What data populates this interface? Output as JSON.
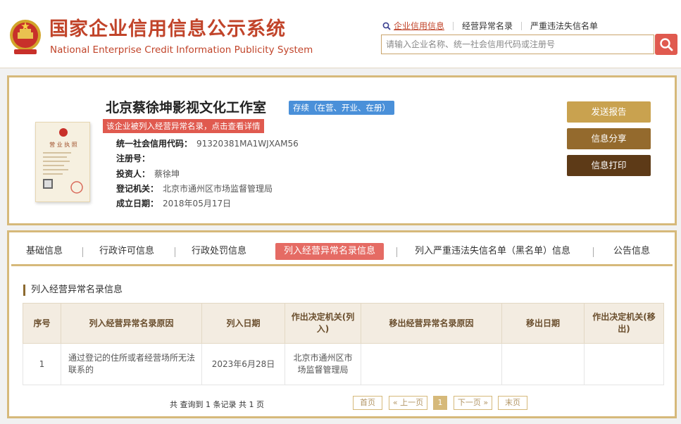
{
  "header": {
    "title_cn": "国家企业信用信息公示系统",
    "title_en": "National Enterprise Credit Information Publicity System",
    "links": [
      "企业信用信息",
      "经营异常名录",
      "严重违法失信名单"
    ],
    "search_placeholder": "请输入企业名称、统一社会信用代码或注册号"
  },
  "company": {
    "name": "北京蔡徐坤影视文化工作室",
    "status": "存续（在营、开业、在册）",
    "alert": "该企业被列入经营异常名录，点击查看详情",
    "fields": [
      {
        "label": "统一社会信用代码：",
        "value": "91320381MA1WJXAM56"
      },
      {
        "label": "注册号：",
        "value": ""
      },
      {
        "label": "投资人：",
        "value": "蔡徐坤"
      },
      {
        "label": "登记机关：",
        "value": "北京市通州区市场监督管理局"
      },
      {
        "label": "成立日期：",
        "value": "2018年05月17日"
      }
    ],
    "license_text": "营 业 执 照",
    "buttons": {
      "report": "发送报告",
      "share": "信息分享",
      "print": "信息打印"
    }
  },
  "tabs": [
    "基础信息",
    "行政许可信息",
    "行政处罚信息",
    "列入经营异常名录信息",
    "列入严重违法失信名单（黑名单）信息",
    "公告信息"
  ],
  "section": {
    "title": "列入经营异常名录信息",
    "columns": [
      "序号",
      "列入经营异常名录原因",
      "列入日期",
      "作出决定机关(列入)",
      "移出经营异常名录原因",
      "移出日期",
      "作出决定机关(移出)"
    ],
    "rows": [
      [
        "1",
        "通过登记的住所或者经营场所无法联系的",
        "2023年6月28日",
        "北京市通州区市场监督管理局",
        "",
        "",
        ""
      ]
    ]
  },
  "pagination": {
    "summary": "共 查询到 1 条记录 共 1 页",
    "first": "首页",
    "prev": "« 上一页",
    "current": "1",
    "next": "下一页 »",
    "last": "末页"
  },
  "colors": {
    "brand_red": "#c1442a",
    "gold": "#d6b97a",
    "active_tab": "#e56b64",
    "status_blue": "#4a90d9"
  }
}
